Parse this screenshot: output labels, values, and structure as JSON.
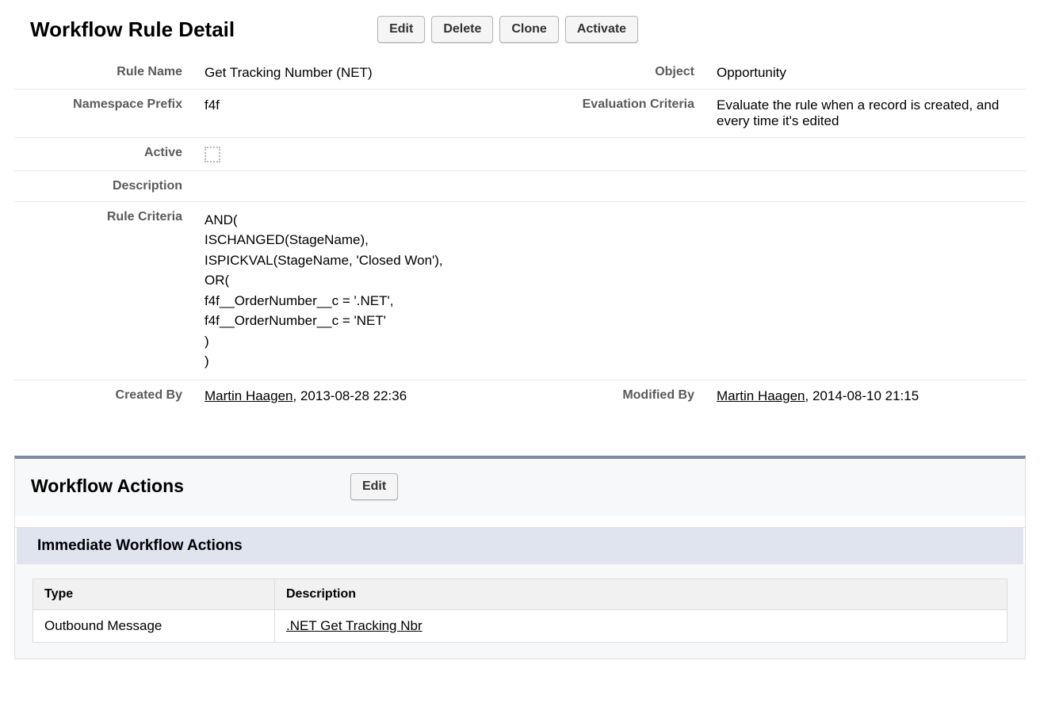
{
  "header": {
    "title": "Workflow Rule Detail",
    "buttons": {
      "edit": "Edit",
      "delete": "Delete",
      "clone": "Clone",
      "activate": "Activate"
    }
  },
  "labels": {
    "ruleName": "Rule Name",
    "object": "Object",
    "namespacePrefix": "Namespace Prefix",
    "evaluationCriteria": "Evaluation Criteria",
    "active": "Active",
    "description": "Description",
    "ruleCriteria": "Rule Criteria",
    "createdBy": "Created By",
    "modifiedBy": "Modified By"
  },
  "values": {
    "ruleName": "Get Tracking Number (NET)",
    "object": "Opportunity",
    "namespacePrefix": "f4f",
    "evaluationCriteria": "Evaluate the rule when a record is created, and every time it's edited",
    "description": "",
    "ruleCriteria": "AND(\nISCHANGED(StageName),\nISPICKVAL(StageName, 'Closed Won'),\nOR(\nf4f__OrderNumber__c = '.NET',\nf4f__OrderNumber__c = 'NET'\n)\n)",
    "createdByName": "Martin Haagen",
    "createdByDate": ", 2013-08-28 22:36",
    "modifiedByName": "Martin Haagen",
    "modifiedByDate": ", 2014-08-10 21:15"
  },
  "actions": {
    "title": "Workflow Actions",
    "editButton": "Edit",
    "immediateTitle": "Immediate Workflow Actions",
    "columns": {
      "type": "Type",
      "description": "Description"
    },
    "rows": [
      {
        "type": "Outbound Message",
        "description": ".NET Get Tracking Nbr"
      }
    ]
  }
}
